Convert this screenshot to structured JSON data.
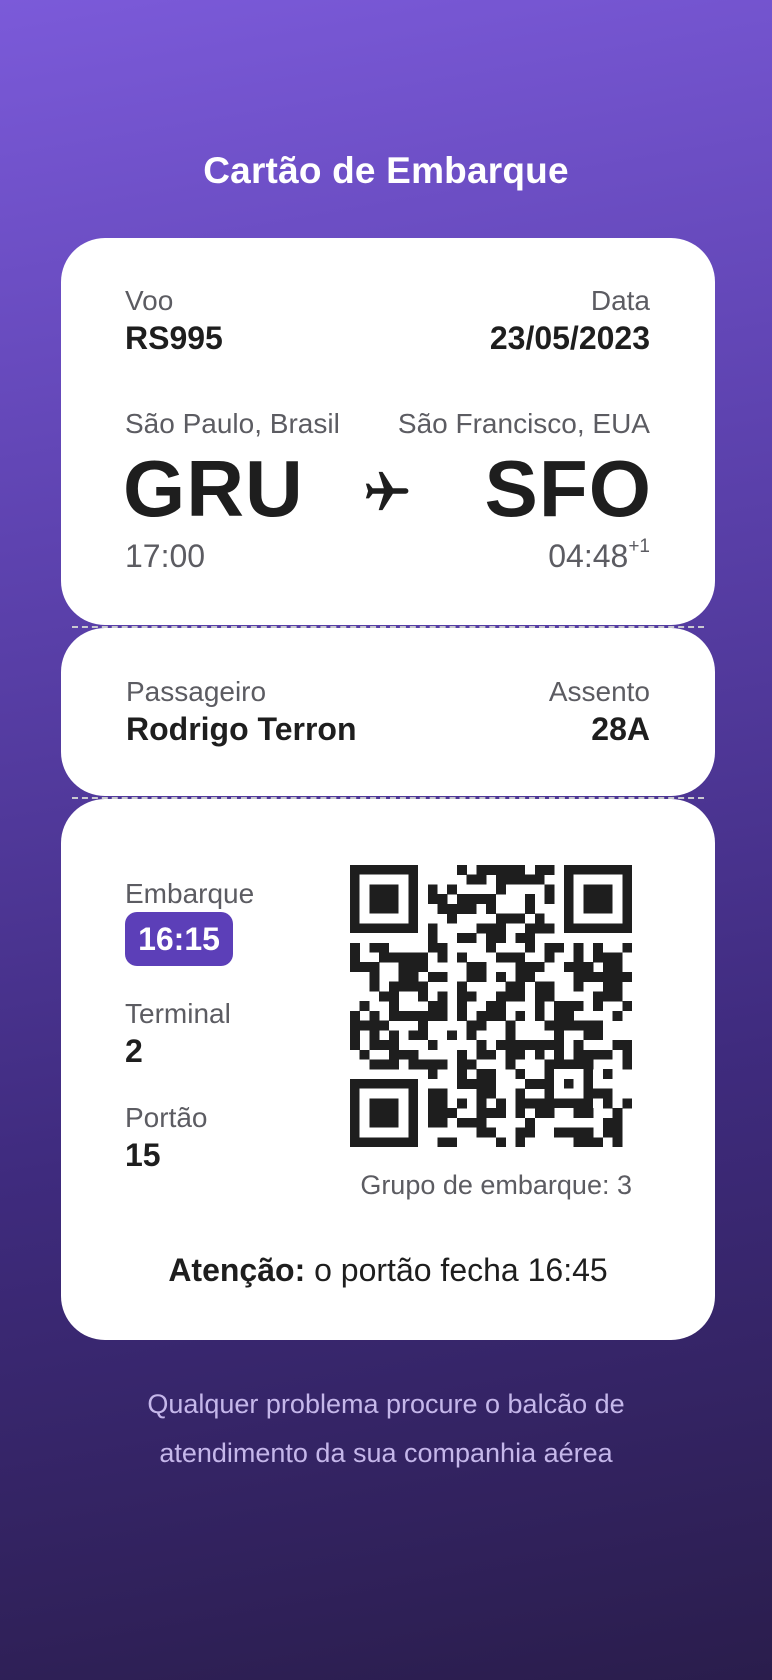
{
  "header": {
    "title": "Cartão de Embarque"
  },
  "flight": {
    "flight_label": "Voo",
    "flight_number": "RS995",
    "date_label": "Data",
    "date": "23/05/2023",
    "origin": {
      "city": "São Paulo, Brasil",
      "code": "GRU",
      "time": "17:00"
    },
    "destination": {
      "city": "São Francisco, EUA",
      "code": "SFO",
      "time": "04:48",
      "day_offset": "+1"
    },
    "icon": "airplane-icon"
  },
  "passenger": {
    "passenger_label": "Passageiro",
    "name": "Rodrigo Terron",
    "seat_label": "Assento",
    "seat": "28A"
  },
  "boarding": {
    "boarding_label": "Embarque",
    "boarding_time": "16:15",
    "terminal_label": "Terminal",
    "terminal": "2",
    "gate_label": "Portão",
    "gate": "15",
    "group_text": "Grupo de embarque: 3",
    "qr_icon": "qr-code",
    "attention_label": "Atenção:",
    "attention_text": "o portão fecha 16:45"
  },
  "footer": {
    "line1": "Qualquer problema procure o balcão de",
    "line2": "atendimento da sua companhia aérea"
  },
  "colors": {
    "accent": "#5c3fb8",
    "background_top": "#7b5ad9",
    "background_bottom": "#2a1d4c",
    "footer_text": "#c5b7ea"
  }
}
